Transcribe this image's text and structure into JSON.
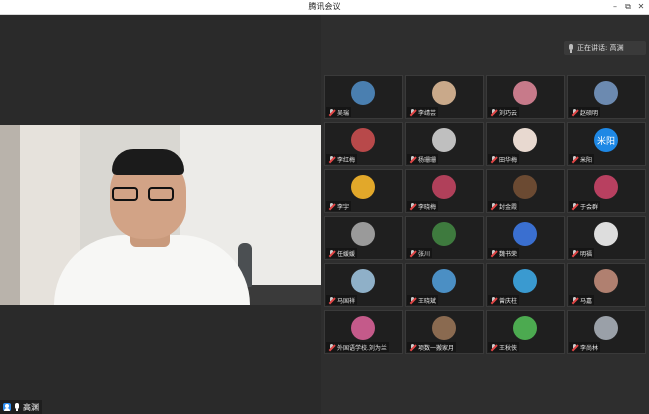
{
  "window": {
    "title": "腾讯会议",
    "minimize": "–",
    "restore": "⧉",
    "close": "✕"
  },
  "main_video": {
    "speaker_name": "高渊"
  },
  "speaking_indicator": {
    "label": "正在讲话: 高渊"
  },
  "participants": [
    {
      "name": "吴瑞",
      "avatar_color": "#4a7fb0"
    },
    {
      "name": "李靖芸",
      "avatar_color": "#c9a98a"
    },
    {
      "name": "刘巧云",
      "avatar_color": "#c77a8a"
    },
    {
      "name": "赵硕明",
      "avatar_color": "#6c8ab0"
    },
    {
      "name": "李红梅",
      "avatar_color": "#b8494a"
    },
    {
      "name": "杨珊珊",
      "avatar_color": "#bfbfbf"
    },
    {
      "name": "田华梅",
      "avatar_color": "#e8d9d0"
    },
    {
      "name": "米阳",
      "avatar_color": "#1e88e5",
      "avatar_text": "米阳"
    },
    {
      "name": "李宇",
      "avatar_color": "#e2a82a"
    },
    {
      "name": "李晓梅",
      "avatar_color": "#b0405a"
    },
    {
      "name": "封金霞",
      "avatar_color": "#6b4a32"
    },
    {
      "name": "于会群",
      "avatar_color": "#b84060"
    },
    {
      "name": "任媛媛",
      "avatar_color": "#9a9a9a"
    },
    {
      "name": "张川",
      "avatar_color": "#3e7a3e"
    },
    {
      "name": "魏书荣",
      "avatar_color": "#3a6fd0"
    },
    {
      "name": "明福",
      "avatar_color": "#dddddd"
    },
    {
      "name": "马国祥",
      "avatar_color": "#8fb0c8"
    },
    {
      "name": "王晓斌",
      "avatar_color": "#4b8fc4"
    },
    {
      "name": "曾庆柱",
      "avatar_color": "#3a9ad0"
    },
    {
      "name": "马嘉",
      "avatar_color": "#b08070"
    },
    {
      "name": "外国语学校.刘为兰",
      "avatar_color": "#c45a8a"
    },
    {
      "name": "项数一搬家月",
      "avatar_color": "#8a6a50"
    },
    {
      "name": "王秋侠",
      "avatar_color": "#4caa50"
    },
    {
      "name": "李尚林",
      "avatar_color": "#9aa0a8"
    }
  ]
}
